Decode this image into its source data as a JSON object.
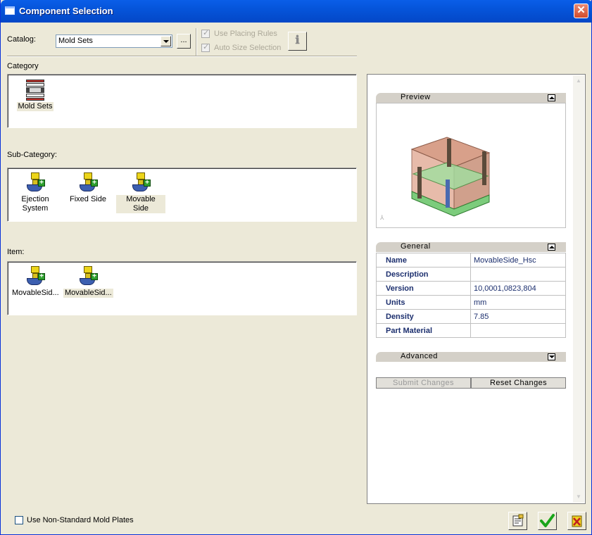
{
  "window": {
    "title": "Component Selection",
    "close_glyph": "✕"
  },
  "catalog": {
    "label": "Catalog:",
    "value": "Mold Sets",
    "browse_label": "..."
  },
  "options": {
    "use_placing_rules": "Use Placing Rules",
    "auto_size_selection": "Auto Size Selection",
    "info_glyph": "ℹ"
  },
  "category": {
    "label": "Category",
    "items": [
      {
        "label": "Mold Sets",
        "icon": "mold-set-icon"
      }
    ]
  },
  "subcategory": {
    "label": "Sub-Category:",
    "items": [
      {
        "label": "Ejection System",
        "icon": "ejection-system-icon"
      },
      {
        "label": "Fixed Side",
        "icon": "fixed-side-icon"
      },
      {
        "label": "Movable Side",
        "icon": "movable-side-icon"
      }
    ]
  },
  "item": {
    "label": "Item:",
    "items": [
      {
        "label": "MovableSid...",
        "icon": "movable-side-item-icon"
      },
      {
        "label": "MovableSid...",
        "icon": "movable-side-item-icon"
      }
    ]
  },
  "preview": {
    "title": "Preview"
  },
  "general": {
    "title": "General",
    "rows": [
      {
        "key": "Name",
        "value": "MovableSide_Hsc"
      },
      {
        "key": "Description",
        "value": ""
      },
      {
        "key": "Version",
        "value": "10,0001,0823,804"
      },
      {
        "key": "Units",
        "value": "mm"
      },
      {
        "key": "Density",
        "value": "7.85"
      },
      {
        "key": "Part Material",
        "value": ""
      }
    ]
  },
  "advanced": {
    "title": "Advanced"
  },
  "actions": {
    "submit": "Submit Changes",
    "reset": "Reset Changes"
  },
  "footer": {
    "non_standard_label": "Use Non-Standard Mold Plates"
  },
  "colors": {
    "title_bar": "#0553d8",
    "dialog_bg": "#ece9d8",
    "table_text": "#1c2f6e"
  }
}
